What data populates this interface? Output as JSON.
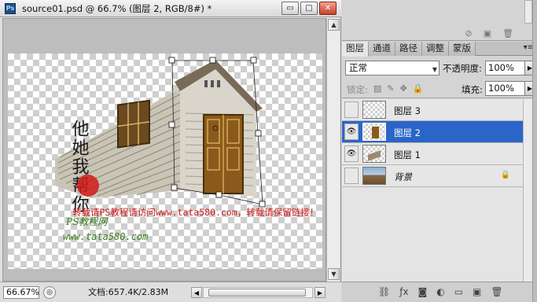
{
  "window": {
    "title": "source01.psd @ 66.7% (图层 2, RGB/8#) *",
    "logo": "Ps",
    "buttons": {
      "minimize": "▭",
      "restore": "□",
      "close": "✕"
    }
  },
  "canvas": {
    "watermark_line": "转载请PS教程请访问www.tata580.com，转载请保留链接！",
    "signature_cn": "PS教程网",
    "signature_url": "www.tata580.com",
    "calligraphy": "他她我帮你"
  },
  "status": {
    "zoom": "66.67%",
    "doc_info": "文档:657.4K/2.83M"
  },
  "layers_panel": {
    "tabs": [
      "图层",
      "通道",
      "路径",
      "调整",
      "蒙版"
    ],
    "active_tab": 0,
    "blend_mode": "正常",
    "opacity_label": "不透明度:",
    "opacity": "100%",
    "lock_label": "锁定:",
    "fill_label": "填充:",
    "fill": "100%",
    "layers": [
      {
        "name": "图层 3",
        "visible": false,
        "selected": false
      },
      {
        "name": "图层 2",
        "visible": true,
        "selected": true
      },
      {
        "name": "图层 1",
        "visible": true,
        "selected": false
      },
      {
        "name": "背景",
        "visible": false,
        "selected": false,
        "locked": true
      }
    ]
  },
  "colors": {
    "selection": "#2a66c8",
    "watermark": "#cc1818",
    "signature": "#3a7a1a"
  }
}
